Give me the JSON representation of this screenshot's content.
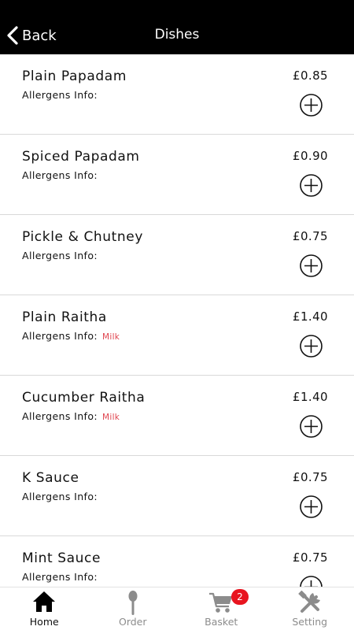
{
  "header": {
    "back_label": "Back",
    "title": "Dishes"
  },
  "allergens_label": "Allergens Info:",
  "items": [
    {
      "name": "Plain Papadam",
      "price": "£0.85",
      "allergens": ""
    },
    {
      "name": "Spiced Papadam",
      "price": "£0.90",
      "allergens": ""
    },
    {
      "name": "Pickle & Chutney",
      "price": "£0.75",
      "allergens": ""
    },
    {
      "name": "Plain Raitha",
      "price": "£1.40",
      "allergens": "Milk"
    },
    {
      "name": "Cucumber Raitha",
      "price": "£1.40",
      "allergens": "Milk"
    },
    {
      "name": "K Sauce",
      "price": "£0.75",
      "allergens": ""
    },
    {
      "name": "Mint Sauce",
      "price": "£0.75",
      "allergens": ""
    }
  ],
  "tabs": [
    {
      "label": "Home",
      "icon": "home-icon",
      "active": true
    },
    {
      "label": "Order",
      "icon": "spoon-icon",
      "active": false
    },
    {
      "label": "Basket",
      "icon": "cart-icon",
      "active": false
    },
    {
      "label": "Setting",
      "icon": "tools-icon",
      "active": false
    }
  ],
  "basket_count": "2",
  "colors": {
    "header_bg": "#000000",
    "allergen": "#e0454f",
    "badge": "#e8141f",
    "inactive_tab": "#8c8c8c"
  }
}
